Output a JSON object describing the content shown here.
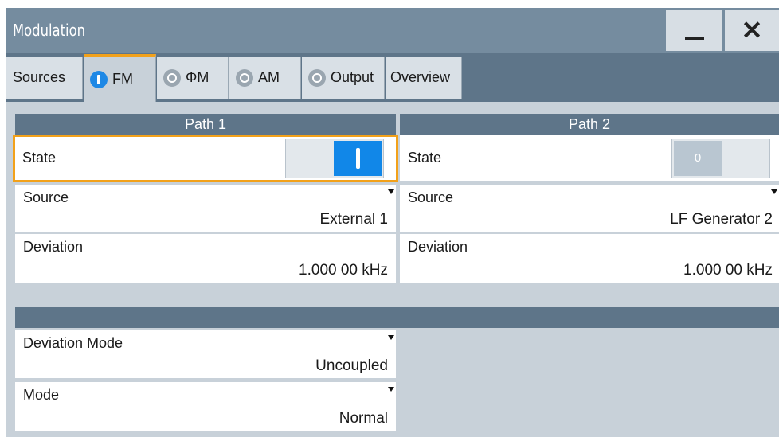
{
  "window": {
    "title": "Modulation",
    "minimize_icon": "minimize-icon",
    "close_icon": "close-icon",
    "close_glyph": "✕"
  },
  "tabs": [
    {
      "label": "Sources",
      "led": "none"
    },
    {
      "label": "FM",
      "led": "on",
      "active": true
    },
    {
      "label": "ΦM",
      "led": "off"
    },
    {
      "label": "AM",
      "led": "off"
    },
    {
      "label": "Output",
      "led": "off"
    },
    {
      "label": "Overview",
      "led": "none"
    }
  ],
  "path1": {
    "header": "Path 1",
    "state": {
      "label": "State",
      "value": "on"
    },
    "source": {
      "label": "Source",
      "value": "External 1"
    },
    "deviation": {
      "label": "Deviation",
      "value": "1.000 00 kHz"
    }
  },
  "path2": {
    "header": "Path 2",
    "state": {
      "label": "State",
      "value": "off",
      "off_text": "0"
    },
    "source": {
      "label": "Source",
      "value": "LF Generator 2"
    },
    "deviation": {
      "label": "Deviation",
      "value": "1.000 00 kHz"
    }
  },
  "common": {
    "deviation_mode": {
      "label": "Deviation Mode",
      "value": "Uncoupled"
    },
    "mode": {
      "label": "Mode",
      "value": "Normal"
    }
  },
  "colors": {
    "accent": "#f2a11a",
    "toggle_on": "#1187e8",
    "header": "#5e7589",
    "titlebar": "#758c9f",
    "panel": "#c8d1d9"
  }
}
